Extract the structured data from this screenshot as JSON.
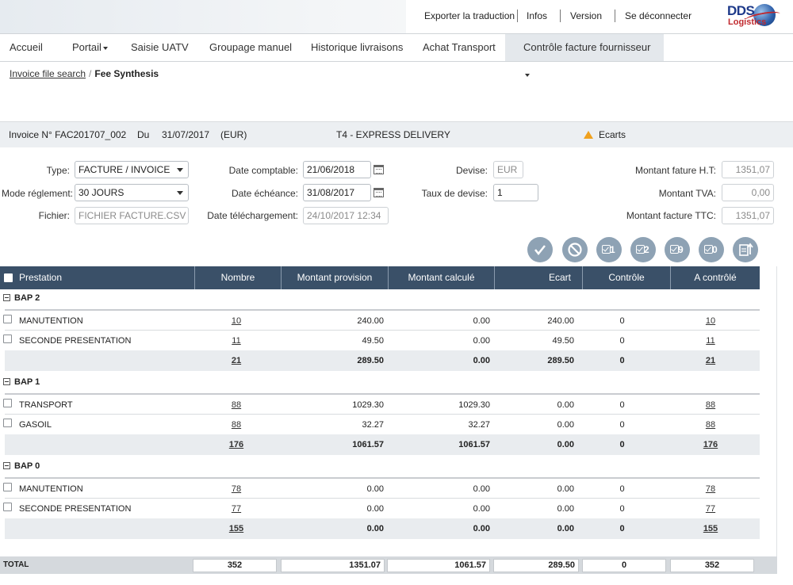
{
  "topbar": {
    "links": [
      "Exporter la traduction",
      "Infos",
      "Version",
      "Se déconnecter"
    ],
    "logo_top": "DDS",
    "logo_bottom": "Logistics"
  },
  "nav": {
    "items": [
      "Accueil",
      "Portail",
      "Saisie UATV",
      "Groupage manuel",
      "Historique livraisons",
      "Achat Transport",
      "Contrôle facture fournisseur"
    ]
  },
  "breadcrumb": {
    "link": "Invoice file search",
    "current": "Fee Synthesis"
  },
  "invoice": {
    "number": "Invoice N° FAC201707_002",
    "du_label": "Du",
    "date": "31/07/2017",
    "currency": "(EUR)",
    "carrier": "T4 - EXPRESS DELIVERY",
    "status": "Ecarts",
    "status_color": "#f0a11e"
  },
  "form": {
    "type_label": "Type:",
    "type_value": "FACTURE / INVOICE",
    "mode_label": "Mode réglement:",
    "mode_value": "30 JOURS",
    "fichier_label": "Fichier:",
    "fichier_value": "FICHIER FACTURE.CSV",
    "date_comptable_label": "Date comptable:",
    "date_comptable_value": "21/06/2018",
    "date_echeance_label": "Date échéance:",
    "date_echeance_value": "31/08/2017",
    "date_telechargement_label": "Date téléchargement:",
    "date_telechargement_value": "24/10/2017 12:34",
    "devise_label": "Devise:",
    "devise_value": "EUR",
    "taux_label": "Taux de devise:",
    "taux_value": "1",
    "montant_ht_label": "Montant fature H.T:",
    "montant_ht_value": "1351,07",
    "montant_tva_label": "Montant TVA:",
    "montant_tva_value": "0,00",
    "montant_ttc_label": "Montant facture TTC:",
    "montant_ttc_value": "1351,07"
  },
  "actions": [
    {
      "icon": "check-icon",
      "num": ""
    },
    {
      "icon": "block-icon",
      "num": ""
    },
    {
      "icon": "checkbox-icon",
      "num": "1"
    },
    {
      "icon": "checkbox-icon",
      "num": "2"
    },
    {
      "icon": "checkbox-icon",
      "num": "9"
    },
    {
      "icon": "checkbox-icon",
      "num": "0"
    },
    {
      "icon": "export-icon",
      "num": ""
    }
  ],
  "table": {
    "headers": [
      "Prestation",
      "Nombre",
      "Montant provision",
      "Montant calculé",
      "Ecart",
      "Contrôle",
      "A contrôlé"
    ],
    "header_color": "#3a5068",
    "groups": [
      {
        "name": "BAP 2",
        "rows": [
          {
            "prestation": "MANUTENTION",
            "nombre": "10",
            "provision": "240.00",
            "calcule": "0.00",
            "ecart": "240.00",
            "controle": "0",
            "a_controle": "10"
          },
          {
            "prestation": "SECONDE PRESENTATION",
            "nombre": "11",
            "provision": "49.50",
            "calcule": "0.00",
            "ecart": "49.50",
            "controle": "0",
            "a_controle": "11"
          }
        ],
        "sum": {
          "nombre": "21",
          "provision": "289.50",
          "calcule": "0.00",
          "ecart": "289.50",
          "controle": "0",
          "a_controle": "21"
        }
      },
      {
        "name": "BAP 1",
        "rows": [
          {
            "prestation": "TRANSPORT",
            "nombre": "88",
            "provision": "1029.30",
            "calcule": "1029.30",
            "ecart": "0.00",
            "controle": "0",
            "a_controle": "88"
          },
          {
            "prestation": "GASOIL",
            "nombre": "88",
            "provision": "32.27",
            "calcule": "32.27",
            "ecart": "0.00",
            "controle": "0",
            "a_controle": "88"
          }
        ],
        "sum": {
          "nombre": "176",
          "provision": "1061.57",
          "calcule": "1061.57",
          "ecart": "0.00",
          "controle": "0",
          "a_controle": "176"
        }
      },
      {
        "name": "BAP 0",
        "rows": [
          {
            "prestation": "MANUTENTION",
            "nombre": "78",
            "provision": "0.00",
            "calcule": "0.00",
            "ecart": "0.00",
            "controle": "0",
            "a_controle": "78"
          },
          {
            "prestation": "SECONDE PRESENTATION",
            "nombre": "77",
            "provision": "0.00",
            "calcule": "0.00",
            "ecart": "0.00",
            "controle": "0",
            "a_controle": "77"
          }
        ],
        "sum": {
          "nombre": "155",
          "provision": "0.00",
          "calcule": "0.00",
          "ecart": "0.00",
          "controle": "0",
          "a_controle": "155"
        }
      }
    ],
    "total": {
      "label": "TOTAL",
      "nombre": "352",
      "provision": "1351.07",
      "calcule": "1061.57",
      "ecart": "289.50",
      "controle": "0",
      "a_controle": "352"
    }
  }
}
